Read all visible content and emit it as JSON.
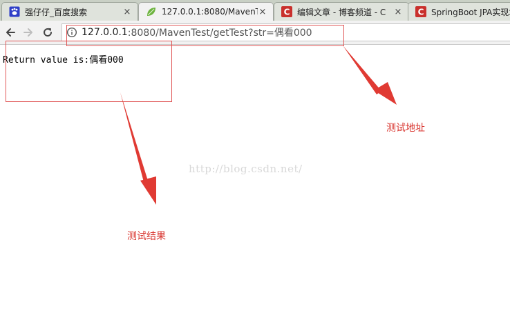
{
  "tabs": [
    {
      "title": "强仔仔_百度搜索",
      "icon": "baidu-paw-icon",
      "close": "×"
    },
    {
      "title": "127.0.0.1:8080/MavenT",
      "icon": "spring-leaf-icon",
      "close": "×"
    },
    {
      "title": "编辑文章 - 博客频道 - C",
      "icon": "csdn-c-icon",
      "close": "×"
    },
    {
      "title": "SpringBoot JPA实现增",
      "icon": "csdn-c-icon",
      "close": "×"
    }
  ],
  "address_bar": {
    "host": "127.0.0.1",
    "rest": ":8080/MavenTest/getTest?str=偶看000"
  },
  "page": {
    "output_text": "Return value is:偶看000",
    "watermark": "http://blog.csdn.net/"
  },
  "annotations": {
    "address_label": "测试地址",
    "result_label": "测试结果"
  },
  "colors": {
    "annotation_red": "#e03a33",
    "tab_active_bg": "#f2f2f2",
    "tab_inactive_bg": "#dfe3dc",
    "csdn_red": "#c9302c",
    "spring_green": "#6db33f",
    "baidu_blue": "#2f3fc8"
  }
}
